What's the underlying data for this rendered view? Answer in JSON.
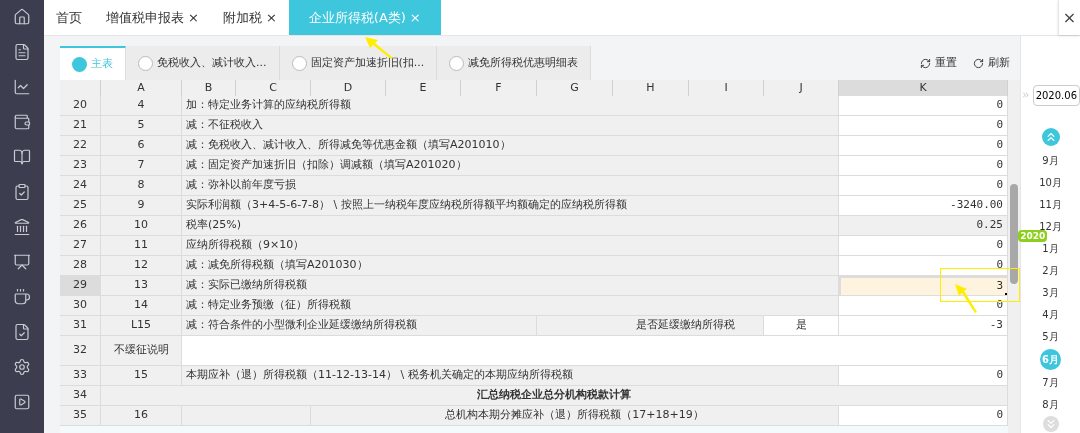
{
  "tabs": [
    {
      "label": "首页",
      "closable": false,
      "selected": false
    },
    {
      "label": "增值税申报表",
      "closable": true,
      "selected": false
    },
    {
      "label": "附加税",
      "closable": true,
      "selected": false
    },
    {
      "label": "企业所得税(A类)",
      "closable": true,
      "selected": true
    }
  ],
  "close_all": "×",
  "close_mark": "×",
  "subtabs": [
    {
      "label": "主表",
      "selected": true
    },
    {
      "label": "免税收入、减计收入...",
      "selected": false
    },
    {
      "label": "固定资产加速折旧(扣...",
      "selected": false
    },
    {
      "label": "减免所得税优惠明细表",
      "selected": false
    }
  ],
  "actions": [
    "重置",
    "刷新"
  ],
  "columns": [
    "A",
    "B",
    "C",
    "D",
    "E",
    "F",
    "G",
    "H",
    "I",
    "J",
    "K"
  ],
  "rows": [
    {
      "kind": "line",
      "num": "20",
      "a": "4",
      "label": "加：特定业务计算的应纳税所得额",
      "value": "0",
      "editable": true,
      "selected": false
    },
    {
      "kind": "line",
      "num": "21",
      "a": "5",
      "label": "减：不征税收入",
      "value": "0",
      "editable": true,
      "selected": false
    },
    {
      "kind": "line",
      "num": "22",
      "a": "6",
      "label": "减：免税收入、减计收入、所得减免等优惠金额（填写A201010）",
      "value": "0",
      "editable": true,
      "selected": false
    },
    {
      "kind": "line",
      "num": "23",
      "a": "7",
      "label": "减：固定资产加速折旧（扣除）调减额（填写A201020）",
      "value": "0",
      "editable": true,
      "selected": false
    },
    {
      "kind": "line",
      "num": "24",
      "a": "8",
      "label": "减：弥补以前年度亏损",
      "value": "0",
      "editable": true,
      "selected": false
    },
    {
      "kind": "line",
      "num": "25",
      "a": "9",
      "label": "实际利润额（3+4-5-6-7-8） \\ 按照上一纳税年度应纳税所得额平均额确定的应纳税所得额",
      "value": "-3240.00",
      "editable": true,
      "selected": false
    },
    {
      "kind": "line",
      "num": "26",
      "a": "10",
      "label": "税率(25%)",
      "value": "0.25",
      "editable": false,
      "selected": false
    },
    {
      "kind": "line",
      "num": "27",
      "a": "11",
      "label": "应纳所得税额（9×10）",
      "value": "0",
      "editable": true,
      "selected": false
    },
    {
      "kind": "line",
      "num": "28",
      "a": "12",
      "label": "减：减免所得税额（填写A201030）",
      "value": "0",
      "editable": true,
      "selected": false
    },
    {
      "kind": "line",
      "num": "29",
      "a": "13",
      "label": "减：实际已缴纳所得税额",
      "value": "3",
      "selected": true
    },
    {
      "kind": "line",
      "num": "30",
      "a": "14",
      "label": "减：特定业务预缴（征）所得税额",
      "value": "0",
      "editable": true,
      "selected": false
    },
    {
      "kind": "deferral",
      "num": "31",
      "a": "L15",
      "label": "减：符合条件的小型微利企业延缓缴纳所得税额",
      "question": "是否延缓缴纳所得税",
      "answer": "是",
      "value": "-3",
      "editable": true,
      "selected": false
    },
    {
      "kind": "note",
      "num": "32",
      "a": "不缓征说明",
      "selected": false
    },
    {
      "kind": "line",
      "num": "33",
      "a": "15",
      "label": "本期应补（退）所得税额（11-12-13-14） \\ 税务机关确定的本期应纳所得税额",
      "value": "0",
      "editable": true,
      "selected": false
    },
    {
      "kind": "section",
      "num": "34",
      "label": "汇总纳税企业总分机构税款计算",
      "selected": false
    },
    {
      "kind": "split",
      "num": "35",
      "a": "16",
      "label": "总机构本期分摊应补（退）所得税额（17+18+19）",
      "value": "0",
      "editable": true,
      "selected": false
    }
  ],
  "period": "2020.06",
  "months": [
    {
      "label": "9月",
      "selected": false
    },
    {
      "label": "10月",
      "selected": false
    },
    {
      "label": "11月",
      "selected": false
    },
    {
      "label": "12月",
      "selected": false
    },
    {
      "label": "1月",
      "selected": false,
      "year": "2020"
    },
    {
      "label": "2月",
      "selected": false
    },
    {
      "label": "3月",
      "selected": false
    },
    {
      "label": "4月",
      "selected": false
    },
    {
      "label": "5月",
      "selected": false
    },
    {
      "label": "6月",
      "selected": true
    },
    {
      "label": "7月",
      "selected": false
    },
    {
      "label": "8月",
      "selected": false
    }
  ]
}
